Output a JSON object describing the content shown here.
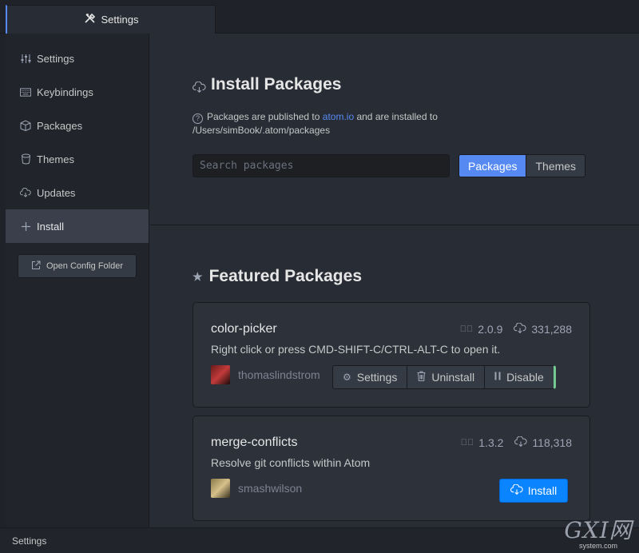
{
  "tab": {
    "title": "Settings",
    "icon": "tools-icon"
  },
  "sidebar": {
    "items": [
      {
        "label": "Settings",
        "icon": "sliders-icon"
      },
      {
        "label": "Keybindings",
        "icon": "keyboard-icon"
      },
      {
        "label": "Packages",
        "icon": "package-icon"
      },
      {
        "label": "Themes",
        "icon": "paintcan-icon"
      },
      {
        "label": "Updates",
        "icon": "cloud-download-icon"
      },
      {
        "label": "Install",
        "icon": "plus-icon"
      }
    ],
    "active": "Install",
    "open_config_label": "Open Config Folder"
  },
  "install": {
    "title": "Install Packages",
    "info_prefix": "Packages are published to ",
    "info_link": "atom.io",
    "info_suffix": " and are installed to",
    "info_path": "/Users/simBook/.atom/packages",
    "search_placeholder": "Search packages",
    "toggle_packages": "Packages",
    "toggle_themes": "Themes"
  },
  "featured": {
    "title": "Featured Packages",
    "packages": [
      {
        "name": "color-picker",
        "version": "2.0.9",
        "downloads": "331,288",
        "description": "Right click or press CMD-SHIFT-C/CTRL-ALT-C to open it.",
        "author": "thomaslindstrom",
        "buttons": {
          "settings": "Settings",
          "uninstall": "Uninstall",
          "disable": "Disable"
        }
      },
      {
        "name": "merge-conflicts",
        "version": "1.3.2",
        "downloads": "118,318",
        "description": "Resolve git conflicts within Atom",
        "author": "smashwilson",
        "buttons": {
          "install": "Install"
        }
      }
    ]
  },
  "status_bar": {
    "text": "Settings"
  },
  "watermark": {
    "logo": "GXI网",
    "sub": "system.com"
  },
  "colors": {
    "accent": "#568af2",
    "install": "#0a84ff",
    "enabled": "#73c990"
  }
}
